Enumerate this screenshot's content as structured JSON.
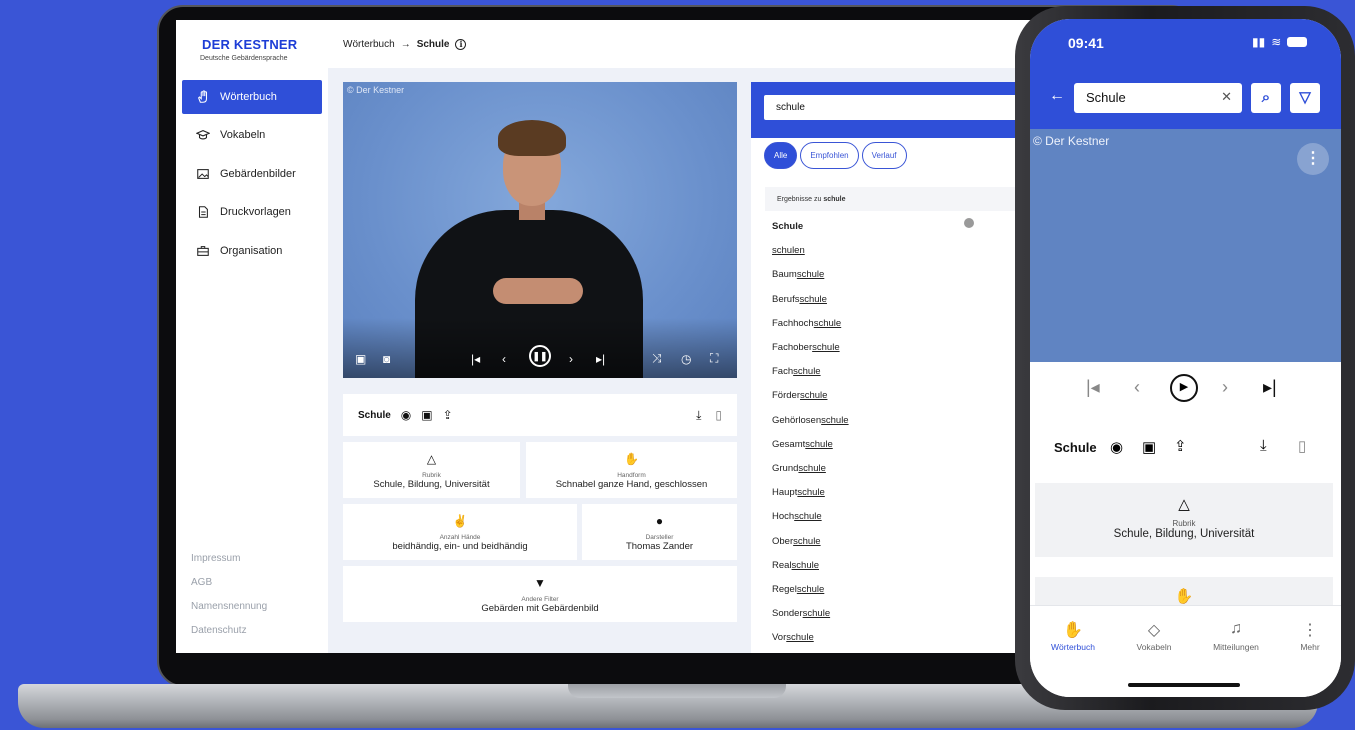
{
  "colors": {
    "brand": "#2f4fd8",
    "background": "#3a55d6"
  },
  "desktop": {
    "logo": {
      "title": "DER KESTNER",
      "subtitle": "Deutsche Gebärdensprache"
    },
    "breadcrumb": {
      "parent": "Wörterbuch",
      "separator": "→",
      "current": "Schule"
    },
    "nav": [
      {
        "label": "Wörterbuch",
        "icon": "hand-icon",
        "active": true
      },
      {
        "label": "Vokabeln",
        "icon": "graduation-cap-icon"
      },
      {
        "label": "Gebärdenbilder",
        "icon": "image-icon"
      },
      {
        "label": "Druckvorlagen",
        "icon": "document-icon"
      },
      {
        "label": "Organisation",
        "icon": "briefcase-icon"
      }
    ],
    "footer": [
      "Impressum",
      "AGB",
      "Namensnennung",
      "Datenschutz"
    ],
    "video": {
      "copyright": "© Der Kestner"
    },
    "word": {
      "label": "Schule"
    },
    "cards": {
      "rubrik": {
        "label": "Rubrik",
        "value": "Schule, Bildung, Universität",
        "icon": "shapes-icon"
      },
      "handform": {
        "label": "Handform",
        "value": "Schnabel ganze Hand, geschlossen",
        "icon": "hand-icon"
      },
      "haende": {
        "label": "Anzahl Hände",
        "value": "beidhändig, ein- und beidhändig",
        "icon": "hands-icon"
      },
      "darsteller": {
        "label": "Darsteller",
        "value": "Thomas Zander",
        "icon": "person-icon"
      },
      "filter": {
        "label": "Andere Filter",
        "value": "Gebärden mit Gebärdenbild",
        "icon": "filter-icon"
      }
    },
    "search": {
      "value": "schule"
    },
    "chips": [
      "Alle",
      "Empfohlen",
      "Verlauf"
    ],
    "results_header": {
      "prefix": "Ergebnisse zu",
      "term": "schule"
    },
    "results": [
      {
        "pre": "Schule",
        "match": ""
      },
      {
        "pre": "",
        "match": "schulen"
      },
      {
        "pre": "Baum",
        "match": "schule"
      },
      {
        "pre": "Berufs",
        "match": "schule"
      },
      {
        "pre": "Fachhoch",
        "match": "schule"
      },
      {
        "pre": "Fachober",
        "match": "schule"
      },
      {
        "pre": "Fach",
        "match": "schule"
      },
      {
        "pre": "Förder",
        "match": "schule"
      },
      {
        "pre": "Gehörlosen",
        "match": "schule"
      },
      {
        "pre": "Gesamt",
        "match": "schule"
      },
      {
        "pre": "Grund",
        "match": "schule"
      },
      {
        "pre": "Haupt",
        "match": "schule"
      },
      {
        "pre": "Hoch",
        "match": "schule"
      },
      {
        "pre": "Ober",
        "match": "schule"
      },
      {
        "pre": "Real",
        "match": "schule"
      },
      {
        "pre": "Regel",
        "match": "schule"
      },
      {
        "pre": "Sonder",
        "match": "schule"
      },
      {
        "pre": "Vor",
        "match": "schule"
      }
    ]
  },
  "phone": {
    "time": "09:41",
    "search": {
      "value": "Schule"
    },
    "video": {
      "copyright": "© Der Kestner"
    },
    "word": {
      "label": "Schule"
    },
    "card": {
      "label": "Rubrik",
      "value": "Schule, Bildung, Universität"
    },
    "tabs": [
      "Wörterbuch",
      "Vokabeln",
      "Mitteilungen",
      "Mehr"
    ]
  }
}
